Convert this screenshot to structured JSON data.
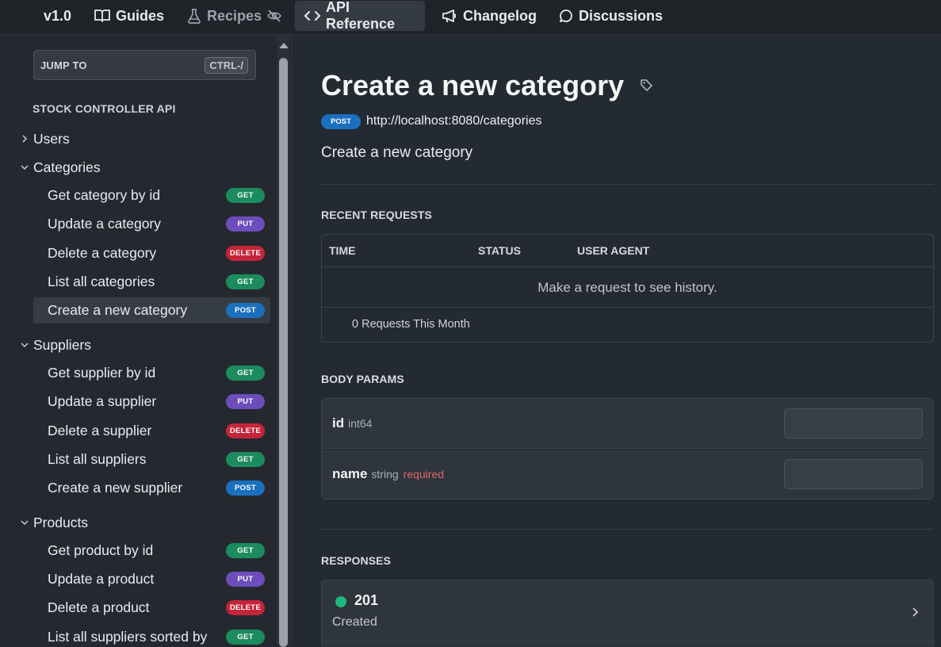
{
  "topnav": {
    "version": "v1.0",
    "guides": "Guides",
    "recipes": "Recipes",
    "api_reference": "API Reference",
    "changelog": "Changelog",
    "discussions": "Discussions"
  },
  "sidebar": {
    "jump_label": "JUMP TO",
    "jump_shortcut": "CTRL-/",
    "section_title": "STOCK CONTROLLER API",
    "groups": [
      {
        "label": "Users",
        "expanded": false,
        "items": []
      },
      {
        "label": "Categories",
        "expanded": true,
        "items": [
          {
            "label": "Get category by id",
            "method": "GET"
          },
          {
            "label": "Update a category",
            "method": "PUT"
          },
          {
            "label": "Delete a category",
            "method": "DELETE"
          },
          {
            "label": "List all categories",
            "method": "GET"
          },
          {
            "label": "Create a new category",
            "method": "POST",
            "active": true
          }
        ]
      },
      {
        "label": "Suppliers",
        "expanded": true,
        "items": [
          {
            "label": "Get supplier by id",
            "method": "GET"
          },
          {
            "label": "Update a supplier",
            "method": "PUT"
          },
          {
            "label": "Delete a supplier",
            "method": "DELETE"
          },
          {
            "label": "List all suppliers",
            "method": "GET"
          },
          {
            "label": "Create a new supplier",
            "method": "POST"
          }
        ]
      },
      {
        "label": "Products",
        "expanded": true,
        "items": [
          {
            "label": "Get product by id",
            "method": "GET"
          },
          {
            "label": "Update a product",
            "method": "PUT"
          },
          {
            "label": "Delete a product",
            "method": "DELETE"
          },
          {
            "label": "List all suppliers sorted by",
            "method": "GET"
          }
        ]
      }
    ]
  },
  "main": {
    "title": "Create a new category",
    "method": "POST",
    "url": "http://localhost:8080/categories",
    "description": "Create a new category",
    "recent_requests": {
      "heading": "RECENT REQUESTS",
      "columns": [
        "TIME",
        "STATUS",
        "USER AGENT"
      ],
      "empty_message": "Make a request to see history.",
      "count_text": "0 Requests This Month"
    },
    "body_params": {
      "heading": "BODY PARAMS",
      "params": [
        {
          "name": "id",
          "type": "int64",
          "required": ""
        },
        {
          "name": "name",
          "type": "string",
          "required": "required"
        }
      ]
    },
    "responses": {
      "heading": "RESPONSES",
      "items": [
        {
          "code": "201",
          "text": "Created"
        }
      ]
    }
  },
  "colors": {
    "get": "#1c8b5d",
    "put": "#6c4dbb",
    "delete": "#c4253a",
    "post": "#1a6fbf",
    "success_dot": "#21b77f",
    "required_text": "#e5646a"
  }
}
